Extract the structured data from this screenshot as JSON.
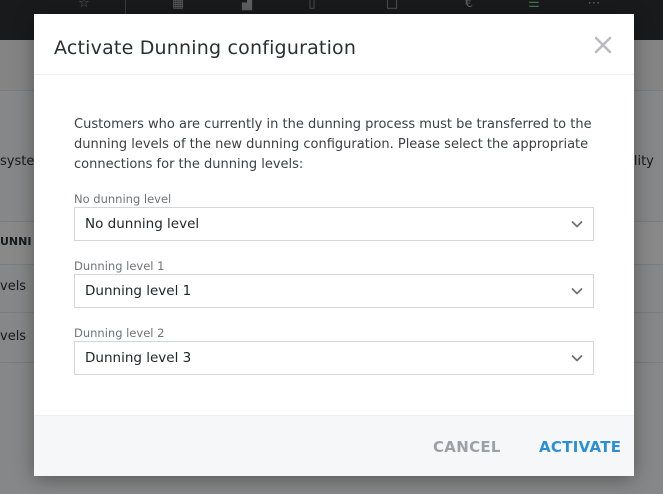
{
  "background": {
    "fragments": {
      "left_system": "syster",
      "right_ability": "bility",
      "header_dunning": "UNNI",
      "row1": "vels",
      "row2": "vels"
    }
  },
  "modal": {
    "title": "Activate Dunning configuration",
    "description": "Customers who are currently in the dunning process must be transferred to the dunning levels of the new dunning configuration. Please select the appropriate connections for the dunning levels:",
    "fields": [
      {
        "label": "No dunning level",
        "value": "No dunning level"
      },
      {
        "label": "Dunning level 1",
        "value": "Dunning level 1"
      },
      {
        "label": "Dunning level 2",
        "value": "Dunning level 3"
      }
    ],
    "buttons": {
      "cancel": "CANCEL",
      "activate": "ACTIVATE"
    }
  },
  "colors": {
    "accent": "#2c8fd6",
    "muted_button": "#9ca1a6",
    "topbar": "#2d3134"
  },
  "icons": {
    "topbar": [
      "star-icon",
      "grid-icon",
      "chart-icon",
      "document-icon",
      "square-icon",
      "euro-icon",
      "sliders-icon",
      "more-icon"
    ],
    "close": "close-icon",
    "select": "chevron-down-icon"
  }
}
